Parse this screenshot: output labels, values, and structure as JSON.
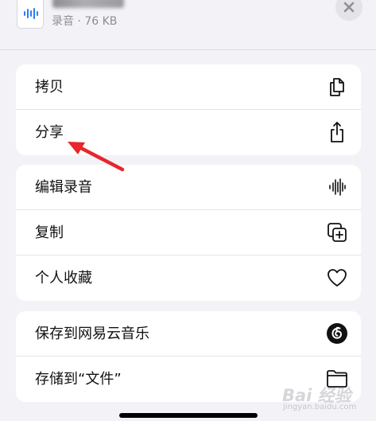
{
  "header": {
    "file_meta": "录音 · 76 KB",
    "file_icon": "waveform-file-icon",
    "close_icon": "close-icon"
  },
  "groups": [
    {
      "rows": [
        {
          "label": "拷贝",
          "icon": "copy-documents-icon"
        },
        {
          "label": "分享",
          "icon": "share-icon"
        }
      ]
    },
    {
      "rows": [
        {
          "label": "编辑录音",
          "icon": "waveform-icon"
        },
        {
          "label": "复制",
          "icon": "duplicate-icon"
        },
        {
          "label": "个人收藏",
          "icon": "heart-icon"
        }
      ]
    },
    {
      "rows": [
        {
          "label": "保存到网易云音乐",
          "icon": "netease-music-icon"
        },
        {
          "label": "存储到“文件”",
          "icon": "folder-icon"
        }
      ]
    }
  ],
  "annotation": {
    "color": "#e8262b"
  },
  "watermark": {
    "text": "Bai 经验",
    "sub": "jingyan.baidu.com"
  }
}
